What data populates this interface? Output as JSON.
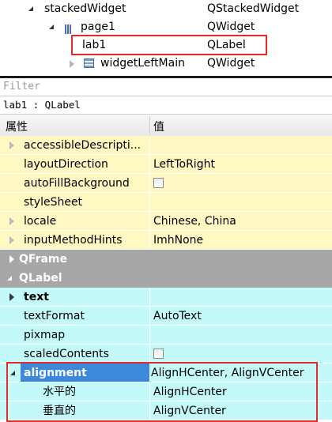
{
  "tree": {
    "rows": [
      {
        "name": "stackedWidget",
        "class": "QStackedWidget"
      },
      {
        "name": "page1",
        "class": "QWidget"
      },
      {
        "name": "lab1",
        "class": "QLabel"
      },
      {
        "name": "widgetLeftMain",
        "class": "QWidget"
      }
    ]
  },
  "filter": {
    "placeholder": "Filter"
  },
  "object_line": "lab1 : QLabel",
  "header": {
    "property": "属性",
    "value": "值"
  },
  "properties": [
    {
      "name": "accessibleDescripti...",
      "value": ""
    },
    {
      "name": "layoutDirection",
      "value": "LeftToRight"
    },
    {
      "name": "autoFillBackground",
      "value": ""
    },
    {
      "name": "styleSheet",
      "value": ""
    },
    {
      "name": "locale",
      "value": "Chinese, China"
    },
    {
      "name": "inputMethodHints",
      "value": "ImhNone"
    },
    {
      "name": "QFrame",
      "value": ""
    },
    {
      "name": "QLabel",
      "value": ""
    },
    {
      "name": "text",
      "value": ""
    },
    {
      "name": "textFormat",
      "value": "AutoText"
    },
    {
      "name": "pixmap",
      "value": ""
    },
    {
      "name": "scaledContents",
      "value": ""
    },
    {
      "name": "alignment",
      "value": "AlignHCenter, AlignVCenter"
    },
    {
      "name": "水平的",
      "value": "AlignHCenter"
    },
    {
      "name": "垂直的",
      "value": "AlignVCenter"
    }
  ],
  "colors": {
    "yellow_row": "#fff8c2",
    "cyan_row": "#c4f9f9",
    "group_row": "#a7a7a7",
    "selection": "#3c89db",
    "highlight_box": "#e22b2b"
  }
}
